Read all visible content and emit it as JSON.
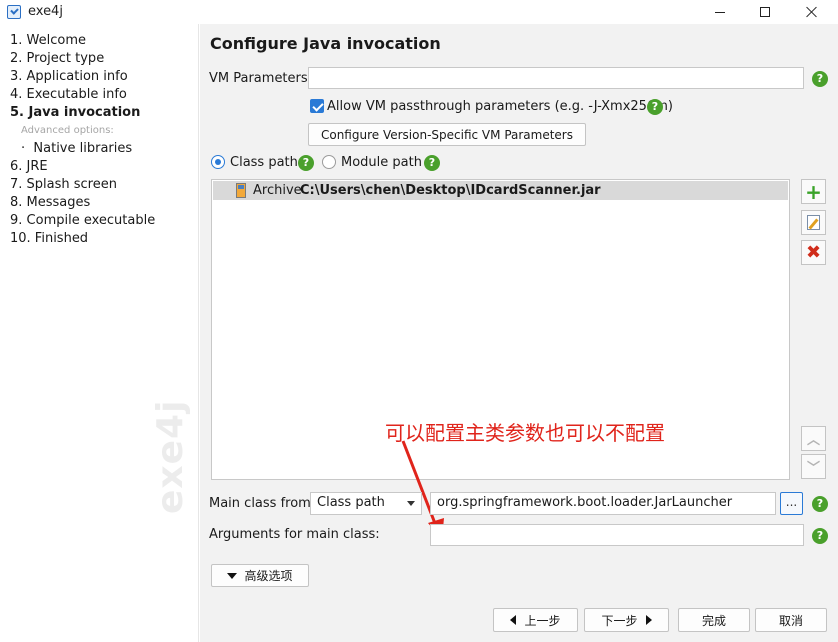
{
  "window": {
    "title": "exe4j"
  },
  "sidebar": {
    "steps": [
      "1. Welcome",
      "2. Project type",
      "3. Application info",
      "4. Executable info",
      "5. Java invocation",
      "6. JRE",
      "7. Splash screen",
      "8. Messages",
      "9. Compile executable",
      "10. Finished"
    ],
    "advanced_label": "Advanced options:",
    "advanced_items": [
      "Native libraries"
    ],
    "watermark": "exe4j"
  },
  "main": {
    "title": "Configure Java invocation",
    "vm_params_label": "VM Parameters:",
    "vm_params_value": "",
    "passthrough_label": "Allow VM passthrough parameters (e.g. -J-Xmx256m)",
    "passthrough_checked": true,
    "version_specific_button": "Configure Version-Specific VM Parameters",
    "classpath_radio_label": "Class path",
    "modulepath_radio_label": "Module path",
    "selected_path_mode": "Class path",
    "classpath_entries": [
      {
        "type": "Archive",
        "path": "C:\\Users\\chen\\Desktop\\IDcardScanner.jar"
      }
    ],
    "annotation_text": "可以配置主类参数也可以不配置",
    "annotation_color": "#e0241b",
    "main_class_label": "Main class from",
    "main_class_source": "Class path",
    "main_class_value": "org.springframework.boot.loader.JarLauncher",
    "browse_button": "...",
    "arguments_label": "Arguments for main class:",
    "arguments_value": "",
    "advanced_button": "高级选项",
    "help_glyph": "?"
  },
  "footer": {
    "back": "上一步",
    "next": "下一步",
    "finish": "完成",
    "cancel": "取消"
  },
  "colors": {
    "accent": "#2a7ad6",
    "help_green": "#4aa02c",
    "add_green": "#3aa329",
    "remove_red": "#d02c1a",
    "panel_bg": "#f2f2f2"
  }
}
